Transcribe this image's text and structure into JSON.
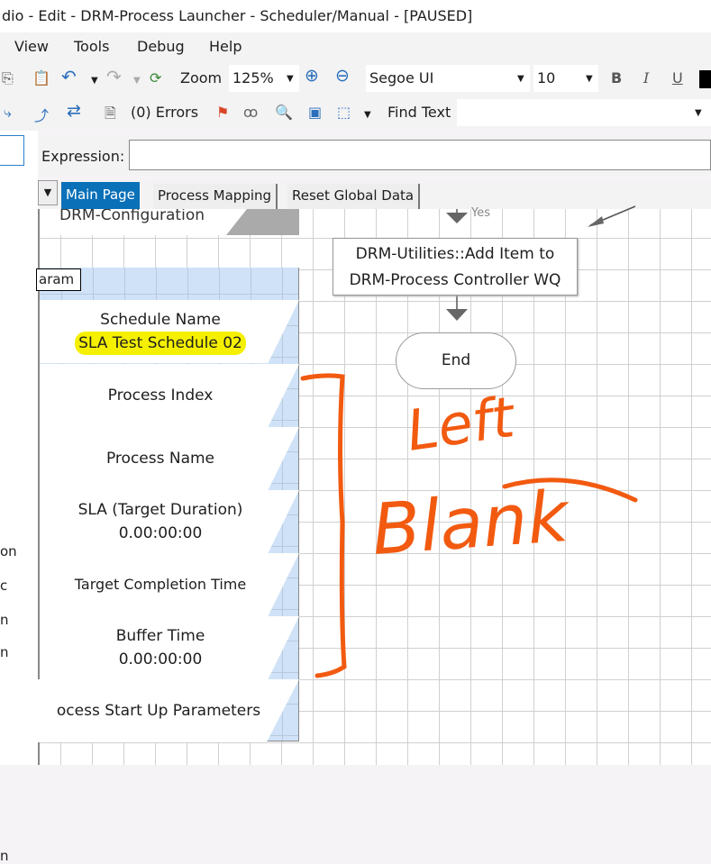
{
  "title": "dio  - Edit - DRM-Process Launcher - Scheduler/Manual - [PAUSED]",
  "menu": [
    "View",
    "Tools",
    "Debug",
    "Help"
  ],
  "toolbar1": {
    "zoom_label": "Zoom",
    "zoom_value": "125%",
    "font": "Segoe UI",
    "size": "10",
    "bold": "B",
    "italic": "I",
    "underline": "U"
  },
  "toolbar2": {
    "errors": "(0) Errors",
    "find_label": "Find Text",
    "find_value": ""
  },
  "expression": {
    "label": "Expression:",
    "value": ""
  },
  "tabs": [
    "Main Page",
    "Process Mapping",
    "Reset Global Data"
  ],
  "left_panel_fragments": [
    "on",
    "c",
    "n",
    "n",
    "n"
  ],
  "canvas": {
    "block_title": "DRM-Configuration",
    "block_label": "aram",
    "data_items": [
      {
        "name": "Schedule Name",
        "value": "SLA Test Schedule 02"
      },
      {
        "name": "Process Index",
        "value": ""
      },
      {
        "name": "Process Name",
        "value": ""
      },
      {
        "name": "SLA (Target Duration)",
        "value": "0.00:00:00"
      },
      {
        "name": "Target Completion Time",
        "value": ""
      },
      {
        "name": "Buffer Time",
        "value": "0.00:00:00"
      },
      {
        "name": "ocess Start Up Parameters",
        "value": ""
      }
    ],
    "yes_label": "Yes",
    "action_line1": "DRM-Utilities::Add Item to",
    "action_line2": "DRM-Process Controller WQ",
    "end_label": "End"
  },
  "annotation": {
    "line1": "Left",
    "line2": "Blank",
    "color": "#f25a10"
  },
  "colors": {
    "tab_active": "#0a70b8",
    "highlight": "#f5f000"
  }
}
